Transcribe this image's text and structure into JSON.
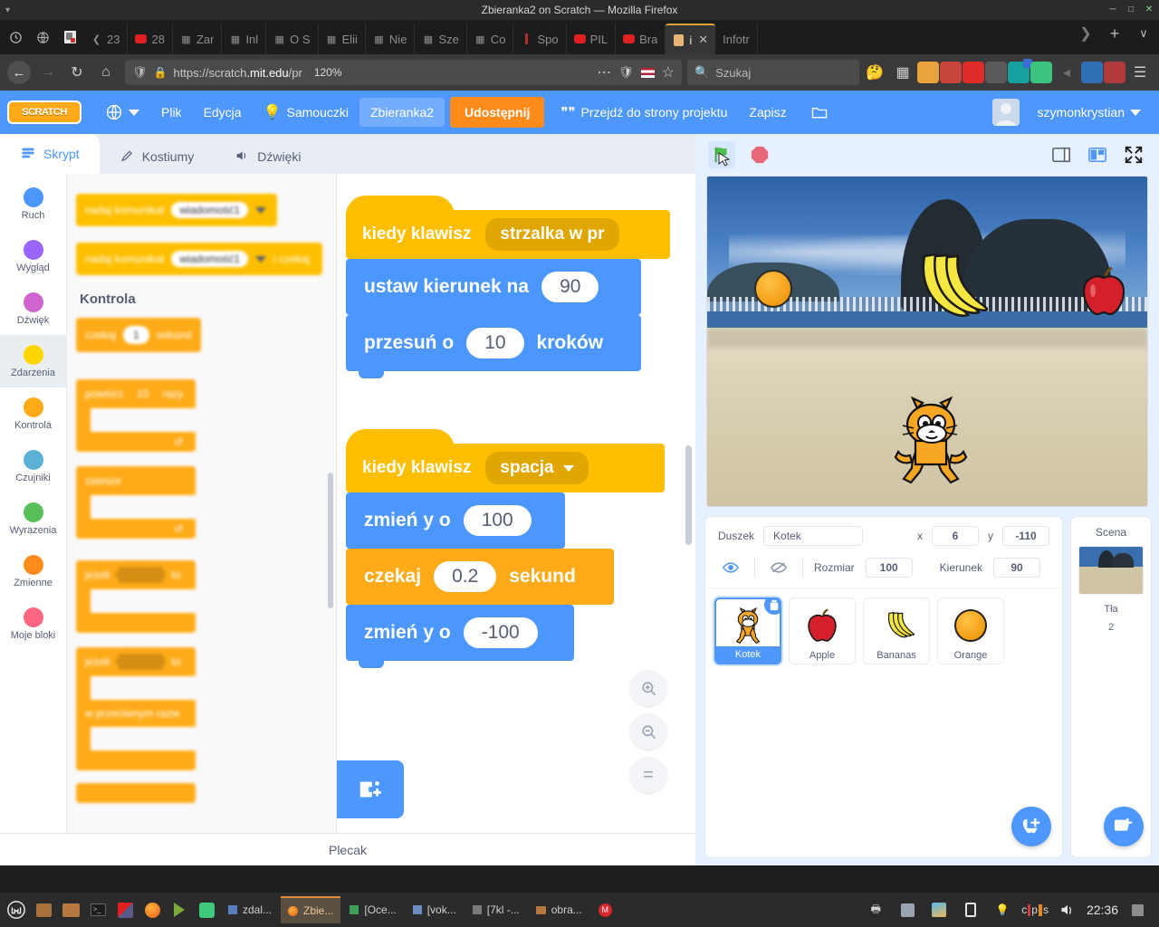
{
  "browser": {
    "window_title": "Zbieranka2 on Scratch — Mozilla Firefox",
    "titlebar_buttons": [
      "minimize",
      "maximize",
      "close"
    ],
    "tabs": [
      {
        "label": "23",
        "icon": "chevron-left-icon"
      },
      {
        "label": "28",
        "icon": "youtube-icon"
      },
      {
        "label": "Zar",
        "icon": "sheets-icon"
      },
      {
        "label": "Inl",
        "icon": "sheets-icon"
      },
      {
        "label": "O S",
        "icon": "sheets-icon"
      },
      {
        "label": "Elii",
        "icon": "sheets-icon"
      },
      {
        "label": "Nie",
        "icon": "sheets-icon"
      },
      {
        "label": "Sze",
        "icon": "sheets-icon"
      },
      {
        "label": "Co",
        "icon": "sheets-icon"
      },
      {
        "label": "Spo",
        "icon": "page-icon"
      },
      {
        "label": "PIL",
        "icon": "youtube-icon"
      },
      {
        "label": "Bra",
        "icon": "youtube-icon"
      },
      {
        "label": "i",
        "icon": "scratch-icon",
        "active": true
      },
      {
        "label": "Infotr",
        "icon": "page-icon"
      }
    ],
    "new_tab_label": "+",
    "tab_list_label": "∨",
    "nav": {
      "back": "←",
      "forward": "→",
      "reload": "↻",
      "home": "⌂"
    },
    "url_prefix": "https://scratch",
    "url_host": ".mit.edu",
    "url_suffix": "/pr",
    "zoom_level": "120%",
    "search_placeholder": "Szukaj",
    "toolbar_icons": [
      "library-icon",
      "sidebar-icon",
      "ublock-icon",
      "pocket-icon",
      "highlighter-icon",
      "grammarly-icon",
      "translate-icon",
      "sync-icon",
      "bookmark-icon",
      "puzzle-icon",
      "color-icon",
      "menu-icon"
    ]
  },
  "scratch_menu": {
    "logo": "SCRATCH",
    "language": "globe-icon",
    "file": "Plik",
    "edit": "Edycja",
    "tutorials": "Samouczki",
    "project_name": "Zbieranka2",
    "share": "Udostępnij",
    "see_project_page": "Przejdź do strony projektu",
    "save": "Zapisz",
    "folder": "folder-icon",
    "username": "szymonkrystian"
  },
  "editor": {
    "tabs": [
      {
        "label": "Skrypt",
        "icon": "code-icon",
        "active": true
      },
      {
        "label": "Kostiumy",
        "icon": "brush-icon",
        "active": false
      },
      {
        "label": "Dźwięki",
        "icon": "sound-icon",
        "active": false
      }
    ],
    "categories": [
      {
        "label": "Ruch",
        "color": "#4c97ff"
      },
      {
        "label": "Wygląd",
        "color": "#9966ff"
      },
      {
        "label": "Dźwięk",
        "color": "#cf63cf"
      },
      {
        "label": "Zdarzenia",
        "color": "#ffd500",
        "selected": true
      },
      {
        "label": "Kontrola",
        "color": "#ffab19"
      },
      {
        "label": "Czujniki",
        "color": "#5cb1d6"
      },
      {
        "label": "Wyrazenia",
        "color": "#59c059"
      },
      {
        "label": "Zmienne",
        "color": "#ff8c1a"
      },
      {
        "label": "Moje bloki",
        "color": "#ff6680"
      }
    ],
    "palette": {
      "blocks_events": [
        {
          "text": "nadaj komunikat",
          "dropdown": "wiadomość1"
        },
        {
          "text": "nadaj komunikat",
          "dropdown": "wiadomość1",
          "suffix": "i czekaj"
        }
      ],
      "section_title": "Kontrola",
      "blocks_control": [
        {
          "text": "czekaj",
          "value": "1",
          "suffix": "sekund"
        },
        {
          "text": "powtórz",
          "value": "10",
          "suffix": "razy"
        },
        {
          "text": "zawsze"
        },
        {
          "text": "jeżeli",
          "suffix": "to"
        },
        {
          "text": "jeżeli",
          "suffix": "to",
          "else": "w przeciwnym razie"
        }
      ]
    },
    "backpack_label": "Plecak",
    "add_extension": "add-extension-icon",
    "zoom_controls": [
      "zoom-in-icon",
      "zoom-out-icon",
      "zoom-reset-icon"
    ],
    "scripts": [
      {
        "hat": {
          "text": "kiedy klawisz",
          "dropdown": "strzalka w pr"
        },
        "blocks": [
          {
            "type": "motion",
            "text_before": "ustaw kierunek na",
            "value": "90",
            "text_after": ""
          },
          {
            "type": "motion",
            "text_before": "przesuń o",
            "value": "10",
            "text_after": "kroków"
          }
        ]
      },
      {
        "hat": {
          "text": "kiedy klawisz",
          "dropdown": "spacja"
        },
        "blocks": [
          {
            "type": "motion",
            "text_before": "zmień y o",
            "value": "100",
            "text_after": ""
          },
          {
            "type": "control",
            "text_before": "czekaj",
            "value": "0.2",
            "text_after": "sekund"
          },
          {
            "type": "motion",
            "text_before": "zmień y o",
            "value": "-100",
            "text_after": ""
          }
        ]
      }
    ]
  },
  "stage": {
    "green_flag": "green-flag-icon",
    "stop": "stop-icon",
    "small_stage_button": "small-stage-icon",
    "large_stage_button": "large-stage-icon",
    "fullscreen_button": "fullscreen-icon",
    "backdrop_description": "Rio de Janeiro beach with Sugarloaf mountain",
    "sprites_on_stage": [
      "Orange",
      "Bananas",
      "Apple",
      "Kotek"
    ]
  },
  "sprite_info": {
    "sprite_label": "Duszek",
    "sprite_name": "Kotek",
    "x_label": "x",
    "x_value": "6",
    "y_label": "y",
    "y_value": "-110",
    "show_label": "pokaz-icon",
    "hide_label": "ukryj-icon",
    "size_label": "Rozmiar",
    "size_value": "100",
    "direction_label": "Kierunek",
    "direction_value": "90"
  },
  "sprites": [
    {
      "name": "Kotek",
      "icon": "scratch-cat-icon",
      "selected": true,
      "delete_badge": "trash-icon"
    },
    {
      "name": "Apple",
      "icon": "apple-icon",
      "selected": false
    },
    {
      "name": "Bananas",
      "icon": "bananas-icon",
      "selected": false
    },
    {
      "name": "Orange",
      "icon": "orange-icon",
      "selected": false
    }
  ],
  "add_sprite_button": "add-sprite-icon",
  "stage_panel": {
    "title": "Scena",
    "backdrop_label": "Tła",
    "backdrop_count": "2",
    "add_backdrop_button": "add-backdrop-icon"
  },
  "taskbar": {
    "menu_icon": "linux-mint-icon",
    "quick_icons": [
      "files-icon",
      "folder-icon",
      "terminal-icon",
      "flowblade-icon",
      "firefox-icon",
      "shotcut-icon",
      "notes-icon"
    ],
    "tasks": [
      {
        "label": "zdal...",
        "icon": "window-icon",
        "active": false
      },
      {
        "label": "Zbie...",
        "icon": "firefox-icon",
        "active": true
      },
      {
        "label": "[Oce...",
        "icon": "window-icon",
        "active": false
      },
      {
        "label": "[vok...",
        "icon": "window-icon",
        "active": false
      },
      {
        "label": "[7kl -...",
        "icon": "window-icon",
        "active": false
      },
      {
        "label": "obra...",
        "icon": "folder-icon",
        "active": false
      },
      {
        "label": "",
        "icon": "mega-icon",
        "active": false
      }
    ],
    "tray_icons": [
      "printer-icon",
      "update-icon",
      "weather-icon",
      "battery-icon",
      "bulb-icon"
    ],
    "keyboard_indicator": [
      "c",
      "p",
      "s"
    ],
    "volume_icon": "volume-icon",
    "clock": "22:36",
    "show-desktop": "show-desktop-icon"
  }
}
